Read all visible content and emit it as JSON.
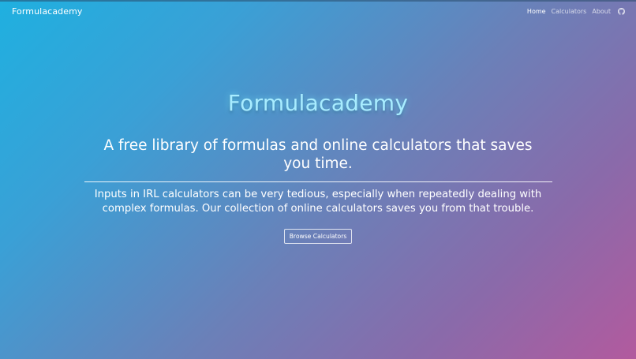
{
  "navbar": {
    "brand": "Formulacademy",
    "links": [
      {
        "label": "Home",
        "active": true
      },
      {
        "label": "Calculators",
        "active": false
      },
      {
        "label": "About",
        "active": false
      }
    ],
    "github_icon": "github-icon"
  },
  "hero": {
    "title": "Formulacademy",
    "tagline": "A free library of formulas and online calculators that saves you time.",
    "description": "Inputs in IRL calculators can be very tedious, especially when repeatedly dealing with complex formulas. Our collection of online calculators saves you from that trouble.",
    "button_label": "Browse Calculators"
  },
  "colors": {
    "gradient_start": "#1fb0e0",
    "gradient_end": "#b25a9e",
    "title_glow": "#a8ecff"
  }
}
